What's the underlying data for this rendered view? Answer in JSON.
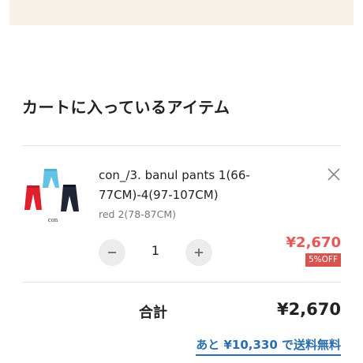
{
  "cart": {
    "title": "カートに入っているアイテム",
    "item": {
      "name": "con_/3. banul pants 1(66-77CM)-4(97-107CM)",
      "variant": "red 2(78-87CM)",
      "quantity": "1",
      "price": "¥2,670",
      "discount": "5%OFF",
      "thumbnail_caption": "con"
    },
    "total_label": "合計",
    "total_value": "¥2,670",
    "free_shipping_message": "あと ¥10,330 で送料無料"
  },
  "icons": {
    "remove": "close-icon",
    "decrease": "minus-icon",
    "increase": "plus-icon"
  },
  "colors": {
    "price": "#e45858",
    "badge": "#d9534f",
    "link": "#2a6fb0",
    "banner": "#f6f0e8"
  }
}
